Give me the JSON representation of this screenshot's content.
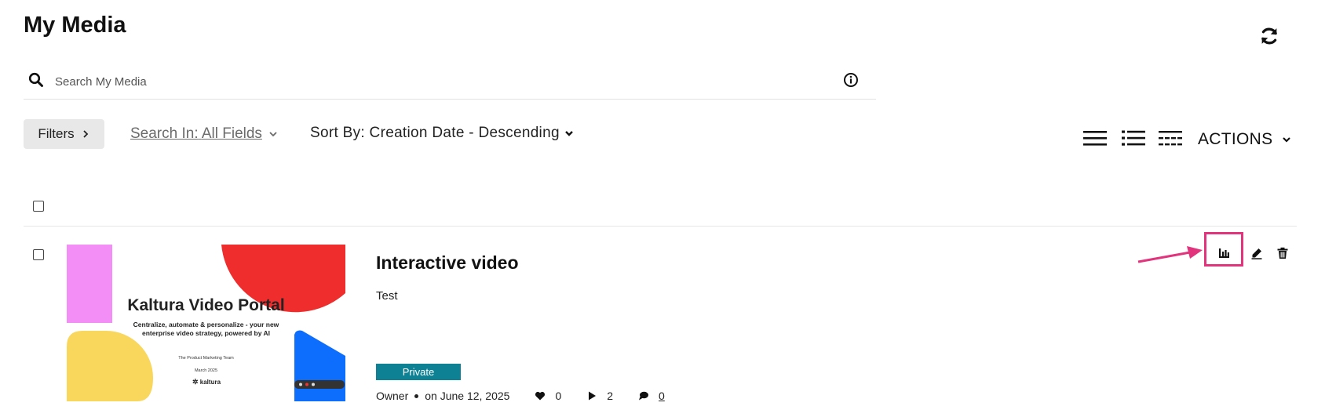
{
  "page": {
    "title": "My Media"
  },
  "search": {
    "placeholder": "Search My Media",
    "value": ""
  },
  "toolbar": {
    "filters_label": "Filters",
    "search_in_prefix": "Search In:",
    "search_in_value": "All Fields",
    "sort_by_label": "Sort By: Creation Date - Descending",
    "actions_label": "ACTIONS",
    "view_modes": [
      "thumbnail-list-icon",
      "detailed-list-icon",
      "compact-grid-icon"
    ]
  },
  "entries": [
    {
      "title": "Interactive video",
      "description": "Test",
      "privacy": "Private",
      "owner": "Owner",
      "date": "on June 12, 2025",
      "likes": "0",
      "plays": "2",
      "comments": "0",
      "thumbnail": {
        "heading": "Kaltura Video Portal",
        "subheading_line1": "Centralize, automate & personalize - your new",
        "subheading_line2": "enterprise video strategy, powered by AI",
        "team": "The Product Marketing Team",
        "date": "March 2025",
        "logo": "kaltura"
      }
    }
  ],
  "colors": {
    "badge": "#0e8294",
    "highlight": "#e2347c",
    "thumb_pink": "#f28ef5",
    "thumb_red": "#ef2d2d",
    "thumb_yellow": "#f9d65c",
    "thumb_blue": "#0d6efd"
  }
}
